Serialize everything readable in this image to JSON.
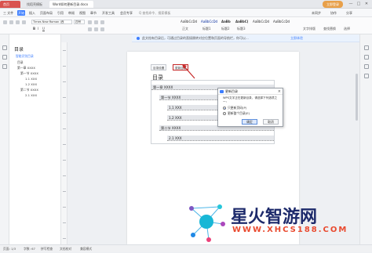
{
  "titlebar": {
    "tabs": [
      {
        "label": "首页"
      },
      {
        "label": "找稻壳模板"
      },
      {
        "label": "Word如何更新目录.docx"
      }
    ],
    "login_label": "立即登录",
    "win_min": "—",
    "win_max": "□",
    "win_close": "✕"
  },
  "menubar": {
    "items": [
      "三 文件",
      "开始",
      "插入",
      "页面布局",
      "引用",
      "审阅",
      "视图",
      "章节",
      "开发工具",
      "会员专享",
      "Q 查找命令、搜索模板"
    ],
    "right": [
      "未同步",
      "协作",
      "分享"
    ]
  },
  "toolbar": {
    "font_name": "Times New Roman (西",
    "font_size": "四号",
    "styles": [
      "AaBbCcDd",
      "AaBbCcDd",
      "AaBb",
      "AaBbC(",
      "AaBbCcDd",
      "AaBbCcDd"
    ],
    "style_names": [
      "正文",
      "标题1",
      "标题2",
      "标题3"
    ],
    "right_labels": [
      "文字排版",
      "查找替换",
      "选择"
    ]
  },
  "notice": {
    "text": "此文档有目录后，可通过目录的直接跳转对应位置和页面的导航栏，你可以...",
    "link": "立即体验"
  },
  "navpane": {
    "title": "目录",
    "header_item": "智能识别目录",
    "items": [
      "目录",
      "第一章 XXXX",
      "第一节 XXXX",
      "1.1 XXX",
      "1.2 XXX",
      "第二节 XXXX",
      "2.1 XXX"
    ]
  },
  "toc_buttons": {
    "settings": "目录设置",
    "update": "更新目录"
  },
  "document": {
    "toc_title": "目录",
    "lines": [
      "第一章 XXXX",
      "第一节 XXXX",
      "1.1 XXX",
      "1.2 XXX",
      "第二节 XXXX",
      "2.1 XXX"
    ]
  },
  "dialog": {
    "title": "更新目录",
    "message": "WPS文字正在更新目录，请选择下列选项之一：",
    "option1": "只更新页码(P)",
    "option2": "更新整个目录(E)",
    "ok": "确定",
    "cancel": "取消"
  },
  "statusbar": {
    "page": "页面: 1/3",
    "words": "字数: 67",
    "spell": "拼写检查",
    "check": "文档校对",
    "compat": "兼容模式"
  },
  "watermark": {
    "text": "星火智游网",
    "url": "WWW.XHCS188.COM"
  },
  "colors": {
    "accent": "#3d7eff",
    "home_tab": "#d9534f",
    "login": "#e8a04a",
    "arrow": "#c62828",
    "watermark_text": "#1d2a6b",
    "watermark_url": "#e94a2f"
  }
}
